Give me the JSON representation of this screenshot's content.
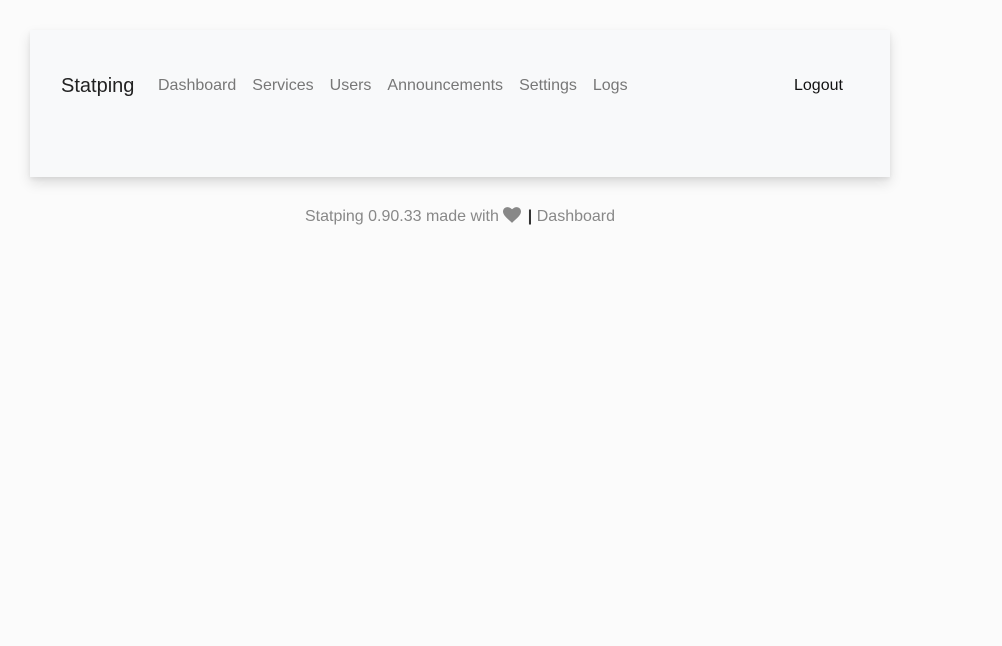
{
  "navbar": {
    "brand": "Statping",
    "links": [
      {
        "label": "Dashboard"
      },
      {
        "label": "Services"
      },
      {
        "label": "Users"
      },
      {
        "label": "Announcements"
      },
      {
        "label": "Settings"
      },
      {
        "label": "Logs"
      }
    ],
    "logout_label": "Logout"
  },
  "footer": {
    "text": "Statping 0.90.33 made with",
    "icon": "heart-icon",
    "separator": "|",
    "link_label": "Dashboard"
  },
  "colors": {
    "page_bg": "#fbfbfb",
    "card_bg": "#f8f9fa",
    "muted_text": "#777777",
    "heart": "#888888"
  }
}
